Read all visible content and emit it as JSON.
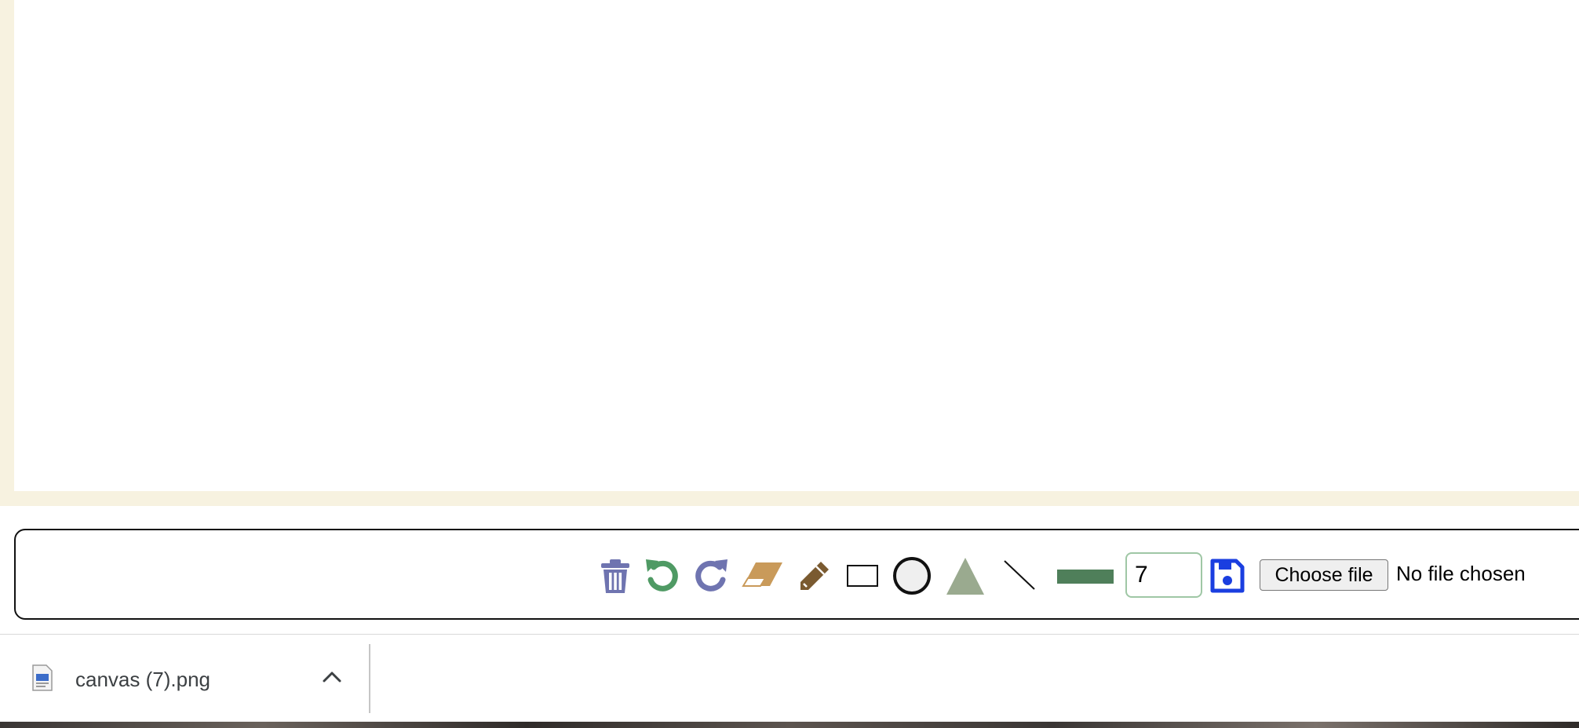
{
  "toolbar": {
    "tools": {
      "clear": "trash-icon",
      "undo": "undo-icon",
      "redo": "redo-icon",
      "eraser": "eraser-icon",
      "pencil": "pencil-icon",
      "rectangle": "rectangle-icon",
      "circle": "circle-icon",
      "triangle": "triangle-icon",
      "line": "line-icon",
      "color": "color-swatch",
      "save": "save-icon"
    },
    "colors": {
      "trash": "#6f74b0",
      "undo": "#4f9a64",
      "redo": "#6f74b0",
      "eraser": "#c99a5a",
      "pencil": "#7a5a30",
      "triangle": "#9aaa8f",
      "swatch": "#4f7f5a",
      "save": "#1a3ee0"
    },
    "brush_size": "7",
    "file_button_label": "Choose file",
    "file_status": "No file chosen"
  },
  "downloads": {
    "file_name": "canvas (7).png"
  }
}
